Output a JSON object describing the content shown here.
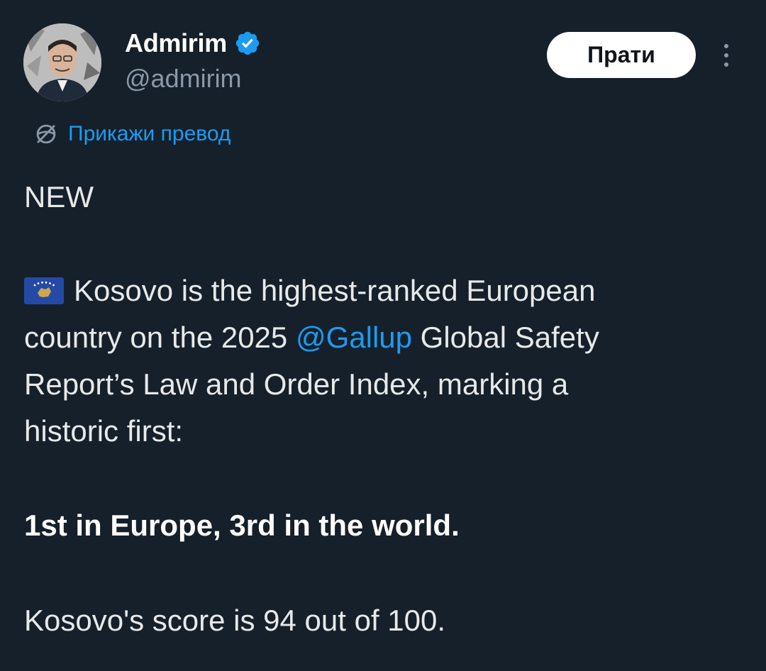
{
  "author": {
    "display_name": "Admirim",
    "handle": "@admirim",
    "verified": true
  },
  "actions": {
    "follow_label": "Прати",
    "more_icon": "more-vertical-icon"
  },
  "translate": {
    "label": "Прикажи превод",
    "icon": "translate-globe-icon"
  },
  "tweet": {
    "line_new": "NEW",
    "flag_icon": "kosovo-flag-icon",
    "p1_line1": "Kosovo is the highest-ranked European",
    "p1_line2_before": "country on the 2025 ",
    "p1_mention": "@Gallup",
    "p1_line2_after": " Global Safety",
    "p1_line3": "Report’s Law and Order Index, marking a",
    "p1_line4": "historic first:",
    "p2_bold": "1st in Europe, 3rd in the world.",
    "p3": "Kosovo's score is 94 out of 100."
  },
  "colors": {
    "background": "#15202b",
    "accent": "#1d9bf0",
    "muted": "#8b98a5",
    "text": "#e7e9ea"
  }
}
